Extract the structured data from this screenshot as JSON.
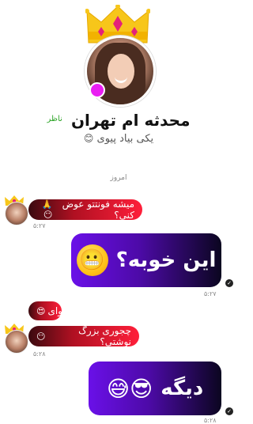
{
  "profile": {
    "name": "محدثه ام تهران",
    "badge": "ناظر",
    "status": "یکی بیاد پیوی",
    "status_emoji": "😊"
  },
  "chat": {
    "date_label": "امروز",
    "messages": [
      {
        "side": "incoming",
        "text": "میشه فونتتو عوض کنی؟",
        "emoji": "🙏😶",
        "time": "۵:۲۷"
      },
      {
        "side": "outgoing",
        "text": "این خوبه؟",
        "emoji": "😬",
        "time": "۵:۲۷"
      },
      {
        "side": "incoming",
        "text": "وای",
        "emoji": "😍"
      },
      {
        "side": "incoming",
        "text": "چجوری بزرگ نوشتی؟",
        "emoji": "😶",
        "time": "۵:۲۸"
      },
      {
        "side": "outgoing",
        "text": "دیگه",
        "emoji": "😎😅",
        "time": "۵:۲۸"
      }
    ]
  },
  "colors": {
    "online": "#e91ef2",
    "incoming_bubble": "#ff1f3a",
    "outgoing_bubble": "#6a10e8",
    "badge": "#2fa52a"
  },
  "icons": [
    "crown-icon",
    "read-check-icon"
  ]
}
